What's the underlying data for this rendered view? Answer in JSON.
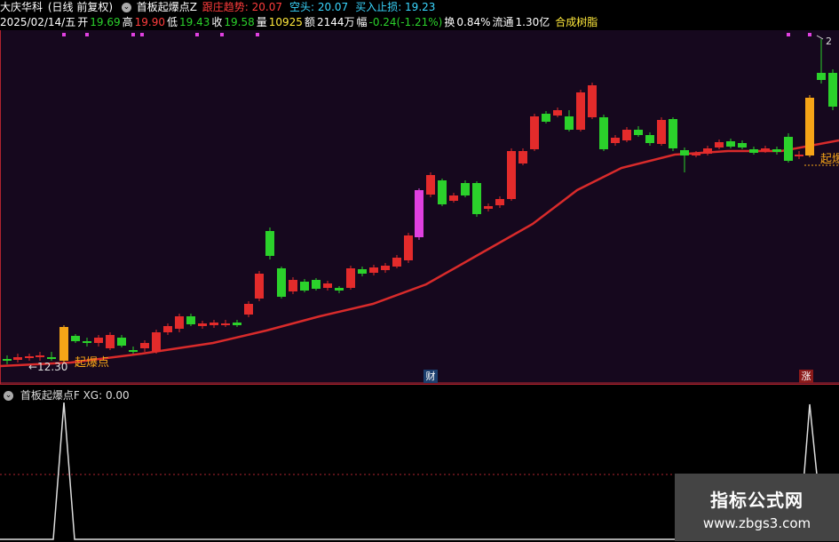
{
  "header": {
    "stock_name": "大庆华科",
    "period": "(日线 前复权)",
    "indicator_name": "首板起爆点Z",
    "indicators": [
      {
        "label": "跟庄趋势:",
        "value": "20.07",
        "color": "#ff3c3c"
      },
      {
        "label": "空头:",
        "value": "20.07",
        "color": "#3ad7ff"
      },
      {
        "label": "买入止损:",
        "value": "19.23",
        "color": "#3ad7ff"
      }
    ]
  },
  "info": {
    "date": "2025/02/14/五",
    "open_label": "开",
    "open": "19.69",
    "high_label": "高",
    "high": "19.90",
    "low_label": "低",
    "low": "19.43",
    "close_label": "收",
    "close": "19.58",
    "volume_label": "量",
    "volume": "10925",
    "amount_label": "额",
    "amount": "2144万",
    "change_label": "幅",
    "change": "-0.24(-1.21%)",
    "turnover_label": "换",
    "turnover": "0.84%",
    "float_label": "流通",
    "float_cap": "1.30亿",
    "concept": "合成树脂"
  },
  "chart_labels": {
    "low_marker": "←12.30",
    "signal_left": "起爆点",
    "signal_right": "起爆",
    "right_top": "2",
    "badge_cai": "财",
    "badge_zhang": "涨"
  },
  "sub_panel": {
    "indicator_name": "首板起爆点F",
    "readout": "XG: 0.00"
  },
  "watermark": {
    "title": "指标公式网",
    "url": "www.zbgs3.com"
  },
  "colors": {
    "up": "#e32b2b",
    "down": "#2bd12b",
    "signal": "#f5a417",
    "highlight": "#e040e0",
    "ma": "#d92b2b"
  }
}
